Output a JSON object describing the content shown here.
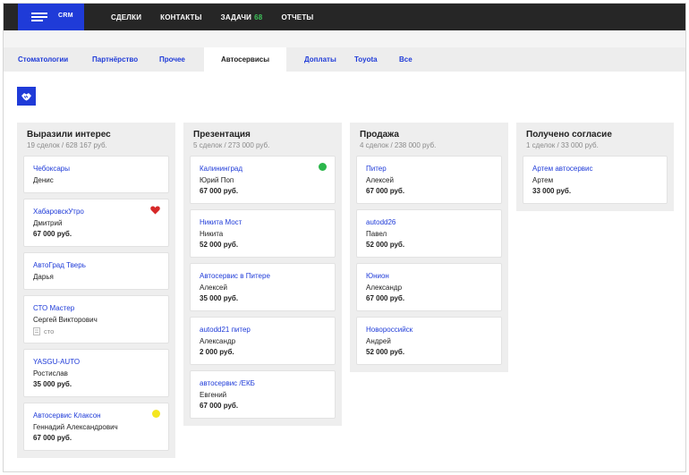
{
  "app": {
    "label": "CRM"
  },
  "nav": [
    {
      "label": "СДЕЛКИ"
    },
    {
      "label": "КОНТАКТЫ"
    },
    {
      "label": "ЗАДАЧИ",
      "count": "68"
    },
    {
      "label": "ОТЧЕТЫ"
    }
  ],
  "tabs": [
    {
      "label": "Стоматологии"
    },
    {
      "label": "Партнёрство"
    },
    {
      "label": "Прочее"
    },
    {
      "label": "Автосервисы",
      "active": true
    },
    {
      "label": "Доплаты"
    },
    {
      "label": "Toyota"
    },
    {
      "label": "Все"
    }
  ],
  "toolbar": {
    "icon": "handshake-icon"
  },
  "colors": {
    "accent": "#1f3bd8",
    "topbar": "#262626",
    "task_count": "#3ec15a",
    "green_marker": "#2bb64b",
    "yellow_marker": "#f4e61f",
    "heart": "#d62828"
  },
  "columns": [
    {
      "title": "Выразили интерес",
      "summary": "19 сделок / 628 167 руб.",
      "cards": [
        {
          "name": "Чебоксары",
          "person": "Денис"
        },
        {
          "name": "ХабаровскУтро",
          "person": "Дмитрий",
          "price": "67 000 руб.",
          "marker": "heart-icon"
        },
        {
          "name": "АвтоГрад Тверь",
          "person": "Дарья"
        },
        {
          "name": "СТО Мастер",
          "person": "Сергей Викторович",
          "tag": "сто"
        },
        {
          "name": "YASGU-AUTO",
          "person": "Ростислав",
          "price": "35 000 руб."
        },
        {
          "name": "Автосервис Клаксон",
          "person": "Геннадий Александрович",
          "price": "67 000 руб.",
          "marker": "yellow-dot"
        }
      ]
    },
    {
      "title": "Презентация",
      "summary": "5 сделок / 273 000 руб.",
      "cards": [
        {
          "name": "Калининград",
          "person": "Юрий Поп",
          "price": "67 000 руб.",
          "marker": "green-dot"
        },
        {
          "name": "Никита Мост",
          "person": "Никита",
          "price": "52 000 руб."
        },
        {
          "name": "Автосервис в Питере",
          "person": "Алексей",
          "price": "35 000 руб."
        },
        {
          "name": "autodd21 питер",
          "person": "Александр",
          "price": "2 000 руб."
        },
        {
          "name": "автосервис  /ЕКБ",
          "person": "Евгений",
          "price": "67 000 руб."
        }
      ]
    },
    {
      "title": "Продажа",
      "summary": "4 сделок / 238 000 руб.",
      "cards": [
        {
          "name": "Питер",
          "person": "Алексей",
          "price": "67 000 руб."
        },
        {
          "name": "autodd26",
          "person": "Павел",
          "price": "52 000 руб."
        },
        {
          "name": "Юнион",
          "person": "Александр",
          "price": "67 000 руб."
        },
        {
          "name": "Новороссийск",
          "person": "Андрей",
          "price": "52 000 руб."
        }
      ]
    },
    {
      "title": "Получено согласие",
      "summary": "1 сделок / 33 000 руб.",
      "cards": [
        {
          "name": "Артем  автосервис",
          "person": "Артем",
          "price": "33 000 руб."
        }
      ]
    }
  ]
}
